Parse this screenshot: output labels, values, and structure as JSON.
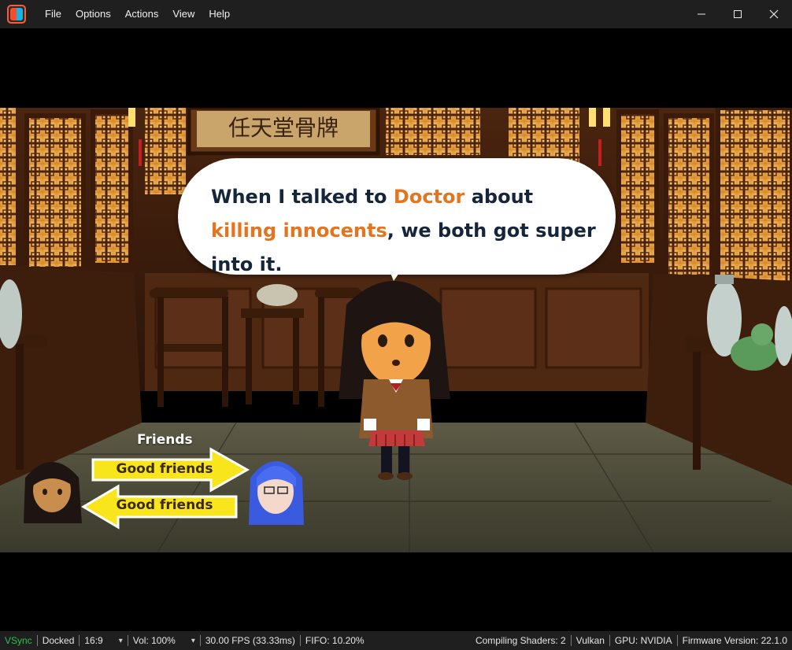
{
  "menu": {
    "items": [
      "File",
      "Options",
      "Actions",
      "View",
      "Help"
    ]
  },
  "window": {
    "minimize_glyph": "—",
    "maximize_glyph": "☐",
    "close_glyph": "✕"
  },
  "game": {
    "sign_text": "任天堂骨牌",
    "dialogue": {
      "part1": "When I talked to ",
      "highlight1": "Doctor",
      "part2": " about ",
      "highlight2": "killing innocents",
      "part3": ", we both got super into it."
    },
    "relationship": {
      "title": "Friends",
      "left_to_right": "Good friends",
      "right_to_left": "Good friends"
    },
    "colors": {
      "highlight": "#e5741f",
      "dialogue_text": "#15263a",
      "arrow_fill": "#f8e51c"
    }
  },
  "status": {
    "vsync": "VSync",
    "dock_mode": "Docked",
    "aspect": "16:9",
    "volume": "Vol: 100%",
    "fps": "30.00 FPS (33.33ms)",
    "fifo": "FIFO: 10.20%",
    "shaders": "Compiling Shaders: 2",
    "backend": "Vulkan",
    "gpu": "GPU: NVIDIA",
    "firmware": "Firmware Version: 22.1.0"
  }
}
